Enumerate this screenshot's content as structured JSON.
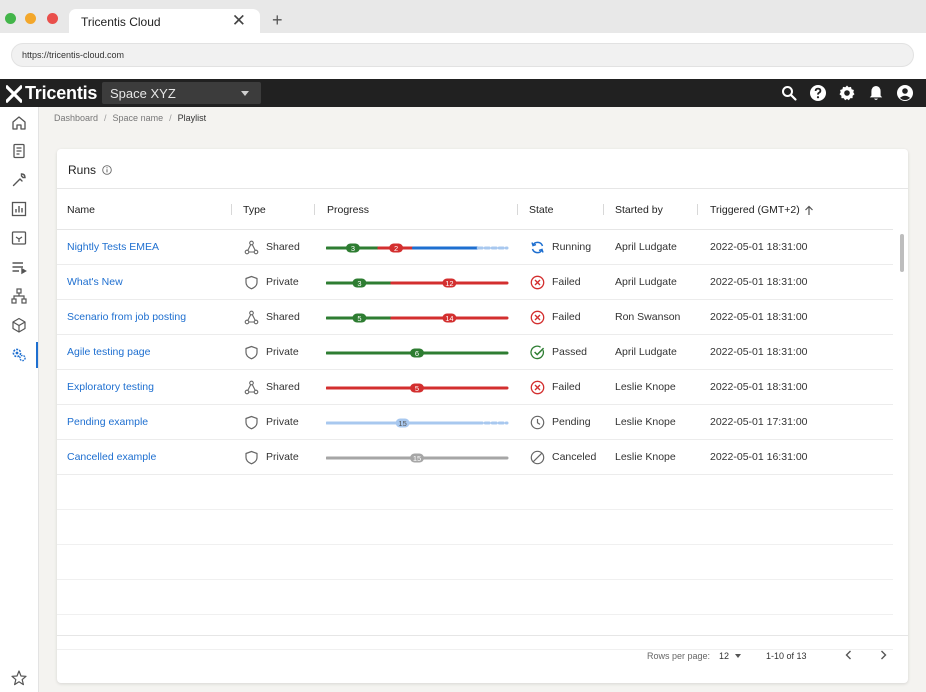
{
  "browser": {
    "tab_title": "Tricentis Cloud",
    "close_glyph": "✕",
    "new_tab_glyph": "+",
    "url": "https://tricentis-cloud.com"
  },
  "header": {
    "logo_text": "Tricentis",
    "space_selector": "Space XYZ",
    "icons": [
      "search-icon",
      "help-icon",
      "settings-icon",
      "notifications-icon",
      "account-icon"
    ]
  },
  "rail": {
    "items": [
      "home-icon",
      "documents-icon",
      "tools-icon",
      "analytics-icon",
      "package-icon",
      "queue-icon",
      "hierarchy-icon",
      "cube-icon",
      "settings-gears-icon",
      "favorites-icon"
    ],
    "active": "settings-gears-icon"
  },
  "breadcrumb": {
    "items": [
      "Dashboard",
      "Space name",
      "Playlist"
    ],
    "separator": "/"
  },
  "runs": {
    "title": "Runs",
    "columns": {
      "name": "Name",
      "type": "Type",
      "progress": "Progress",
      "state": "State",
      "started_by": "Started by",
      "triggered": "Triggered (GMT+2)"
    },
    "rows": [
      {
        "name": "Nightly Tests EMEA",
        "type": "Shared",
        "state": "Running",
        "started_by": "April Ludgate",
        "triggered": "2022-05-01 18:31:00",
        "progress": {
          "passed": 3,
          "failed": 2,
          "running_fraction": 0.36,
          "pending_fraction": 0.16
        }
      },
      {
        "name": "What's New",
        "type": "Private",
        "state": "Failed",
        "started_by": "April Ludgate",
        "triggered": "2022-05-01 18:31:00",
        "progress": {
          "passed": 3,
          "failed": 12
        }
      },
      {
        "name": "Scenario from  job posting",
        "type": "Shared",
        "state": "Failed",
        "started_by": "Ron Swanson",
        "triggered": "2022-05-01 18:31:00",
        "progress": {
          "passed": 5,
          "failed": 14
        }
      },
      {
        "name": "Agile testing page",
        "type": "Private",
        "state": "Passed",
        "started_by": "April Ludgate",
        "triggered": "2022-05-01 18:31:00",
        "progress": {
          "passed": 6
        }
      },
      {
        "name": "Exploratory testing",
        "type": "Shared",
        "state": "Failed",
        "started_by": "Leslie Knope",
        "triggered": "2022-05-01 18:31:00",
        "progress": {
          "failed": 5
        }
      },
      {
        "name": "Pending example",
        "type": "Private",
        "state": "Pending",
        "started_by": "Leslie Knope",
        "triggered": "2022-05-01 17:31:00",
        "progress": {
          "pending": 15
        }
      },
      {
        "name": "Cancelled example",
        "type": "Private",
        "state": "Canceled",
        "started_by": "Leslie Knope",
        "triggered": "2022-05-01 16:31:00",
        "progress": {
          "canceled": 15
        }
      }
    ]
  },
  "pagination": {
    "rows_per_page_label": "Rows per page:",
    "rows_per_page": "12",
    "range": "1-10 of 13"
  },
  "colors": {
    "link": "#1e6fd0",
    "passed": "#2e7d32",
    "failed": "#d32f2f",
    "running": "#1e6fd0",
    "pending": "#a8c8ef",
    "canceled": "#a6a6a6",
    "header_bg": "#212121"
  }
}
